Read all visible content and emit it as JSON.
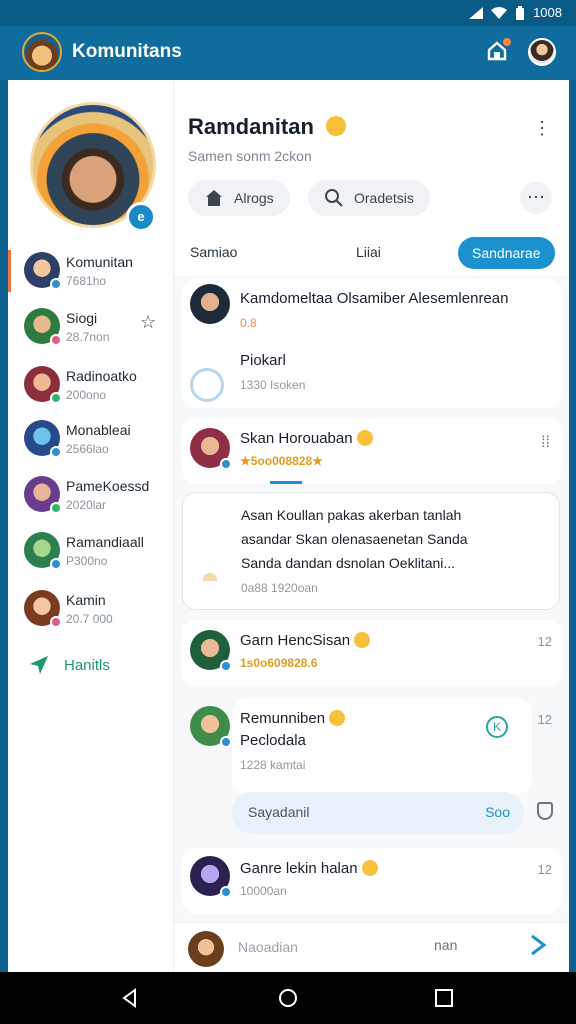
{
  "status": {
    "time": "1008"
  },
  "app": {
    "title": "Komunitans"
  },
  "profile": {
    "badge": "e"
  },
  "sidebar": {
    "items": [
      {
        "name": "Komunitan",
        "sub": "7681ho"
      },
      {
        "name": "Siogi",
        "sub": "28.7non"
      },
      {
        "name": "Radinoatko",
        "sub": "200ono"
      },
      {
        "name": "Monableai",
        "sub": "2566lao"
      },
      {
        "name": "PameKoessd",
        "sub": "2020lar"
      },
      {
        "name": "Ramandiaall",
        "sub": "P300no"
      },
      {
        "name": "Kamin",
        "sub": "20.7 000"
      }
    ],
    "link": "Hanitls"
  },
  "header": {
    "title": "Ramdanitan",
    "subtitle": "Samen sonm 2ckon",
    "pill_1": "Alrogs",
    "pill_2": "Oradetsis"
  },
  "tabs": {
    "t1": "Samiao",
    "t2": "Liiai",
    "t3": "Sandnarae"
  },
  "messages": {
    "m1": {
      "name": "Kamdomeltaa Olsamiber Alesemlenrean",
      "meta": "0.8",
      "body_name": "Piokarl",
      "body_meta": "1330 Isoken"
    },
    "m2": {
      "name": "Skan Horouaban",
      "meta": "★5oo008828★"
    },
    "m3": {
      "line1": "Asan Koullan pakas akerban tanlah",
      "line2": "asandar Skan olenasaenetan Sanda",
      "line3": "Sanda dandan dsnolan Oeklitani...",
      "meta": "0a88 1920oan"
    },
    "m4": {
      "name": "Garn HencSisan",
      "meta": "1s0o609828.6",
      "time": "12"
    },
    "m5": {
      "name": "Remunniben",
      "sub": "Peclodala",
      "meta": "1228 kamtai",
      "time": "12",
      "reply": "Sayadanil",
      "reply_action": "Soo"
    },
    "m6": {
      "name": "Ganre lekin halan",
      "meta": "10000an",
      "time": "12"
    }
  },
  "composer": {
    "placeholder": "Naoadian",
    "tool": "nan"
  },
  "colors": {
    "accent": "#1b92cf",
    "appbar": "#0f6c9d",
    "gold": "#e59a22",
    "active": "#f0743b"
  }
}
